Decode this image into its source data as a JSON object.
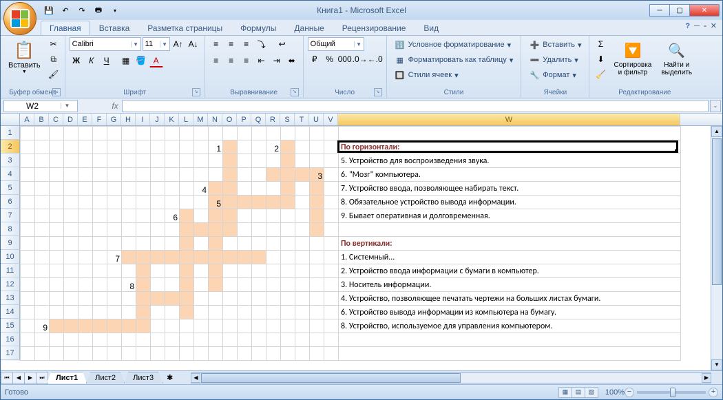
{
  "window": {
    "title": "Книга1 - Microsoft Excel"
  },
  "tabs": {
    "home": "Главная",
    "insert": "Вставка",
    "layout": "Разметка страницы",
    "formulas": "Формулы",
    "data": "Данные",
    "review": "Рецензирование",
    "view": "Вид"
  },
  "ribbon": {
    "clipboard": {
      "label": "Буфер обмена",
      "paste": "Вставить"
    },
    "font": {
      "label": "Шрифт",
      "name": "Calibri",
      "size": "11"
    },
    "alignment": {
      "label": "Выравнивание"
    },
    "number": {
      "label": "Число",
      "format": "Общий"
    },
    "styles": {
      "label": "Стили",
      "cond": "Условное форматирование",
      "table": "Форматировать как таблицу",
      "cell": "Стили ячеек"
    },
    "cells": {
      "label": "Ячейки",
      "insert": "Вставить",
      "delete": "Удалить",
      "format": "Формат"
    },
    "editing": {
      "label": "Редактирование",
      "sort": "Сортировка\nи фильтр",
      "find": "Найти и\nвыделить"
    }
  },
  "namebox": "W2",
  "columns_narrow": [
    "A",
    "B",
    "C",
    "D",
    "E",
    "F",
    "G",
    "H",
    "I",
    "J",
    "K",
    "L",
    "M",
    "N",
    "O",
    "P",
    "Q",
    "R",
    "S",
    "T",
    "U",
    "V"
  ],
  "column_wide": "W",
  "rows": 17,
  "active_cell": {
    "col_index": 22,
    "row_index": 1
  },
  "clue_numbers": {
    "1": {
      "r": 2,
      "c": "N"
    },
    "2": {
      "r": 2,
      "c": "R"
    },
    "3": {
      "r": 4,
      "c": "U"
    },
    "4": {
      "r": 5,
      "c": "M"
    },
    "5": {
      "r": 6,
      "c": "N"
    },
    "6": {
      "r": 7,
      "c": "K"
    },
    "7": {
      "r": 10,
      "c": "G"
    },
    "8": {
      "r": 12,
      "c": "H"
    },
    "9": {
      "r": 15,
      "c": "B"
    }
  },
  "filled_cells": [
    [
      2,
      "O"
    ],
    [
      2,
      "S"
    ],
    [
      3,
      "O"
    ],
    [
      3,
      "S"
    ],
    [
      4,
      "O"
    ],
    [
      4,
      "R"
    ],
    [
      4,
      "S"
    ],
    [
      4,
      "T"
    ],
    [
      4,
      "U"
    ],
    [
      5,
      "N"
    ],
    [
      5,
      "O"
    ],
    [
      5,
      "S"
    ],
    [
      5,
      "U"
    ],
    [
      6,
      "N"
    ],
    [
      6,
      "O"
    ],
    [
      6,
      "P"
    ],
    [
      6,
      "Q"
    ],
    [
      6,
      "R"
    ],
    [
      6,
      "S"
    ],
    [
      6,
      "U"
    ],
    [
      7,
      "L"
    ],
    [
      7,
      "N"
    ],
    [
      7,
      "O"
    ],
    [
      7,
      "U"
    ],
    [
      8,
      "L"
    ],
    [
      8,
      "M"
    ],
    [
      8,
      "N"
    ],
    [
      8,
      "O"
    ],
    [
      8,
      "U"
    ],
    [
      9,
      "L"
    ],
    [
      9,
      "N"
    ],
    [
      10,
      "H"
    ],
    [
      10,
      "I"
    ],
    [
      10,
      "J"
    ],
    [
      10,
      "K"
    ],
    [
      10,
      "L"
    ],
    [
      10,
      "M"
    ],
    [
      10,
      "N"
    ],
    [
      10,
      "O"
    ],
    [
      10,
      "P"
    ],
    [
      10,
      "Q"
    ],
    [
      11,
      "I"
    ],
    [
      11,
      "L"
    ],
    [
      11,
      "N"
    ],
    [
      12,
      "I"
    ],
    [
      12,
      "L"
    ],
    [
      12,
      "N"
    ],
    [
      13,
      "I"
    ],
    [
      13,
      "J"
    ],
    [
      13,
      "K"
    ],
    [
      13,
      "L"
    ],
    [
      14,
      "I"
    ],
    [
      14,
      "L"
    ],
    [
      15,
      "C"
    ],
    [
      15,
      "D"
    ],
    [
      15,
      "E"
    ],
    [
      15,
      "F"
    ],
    [
      15,
      "G"
    ],
    [
      15,
      "H"
    ],
    [
      15,
      "I"
    ]
  ],
  "clues": {
    "2": {
      "text": "По горизонтали:",
      "hdr": true
    },
    "3": {
      "text": "5. Устройство для воспроизведения звука."
    },
    "4": {
      "text": "6. \"Мозг\" компьютера."
    },
    "5": {
      "text": "7. Устройство ввода, позволяющее набирать текст."
    },
    "6": {
      "text": "8. Обязательное устройство вывода информации."
    },
    "7": {
      "text": "9. Бывает оперативная и долговременная."
    },
    "9": {
      "text": "По вертикали:",
      "hdr": true
    },
    "10": {
      "text": "1. Системный..."
    },
    "11": {
      "text": "2. Устройство ввода информации с бумаги в компьютер."
    },
    "12": {
      "text": "3. Носитель информации."
    },
    "13": {
      "text": "4. Устройство, позволяющее печатать чертежи на больших листах бумаги."
    },
    "14": {
      "text": "6. Устройство вывода информации из компьютера на бумагу."
    },
    "15": {
      "text": "8. Устройство, используемое для управления компьютером."
    }
  },
  "sheets": {
    "s1": "Лист1",
    "s2": "Лист2",
    "s3": "Лист3"
  },
  "status": {
    "ready": "Готово",
    "zoom": "100%"
  }
}
